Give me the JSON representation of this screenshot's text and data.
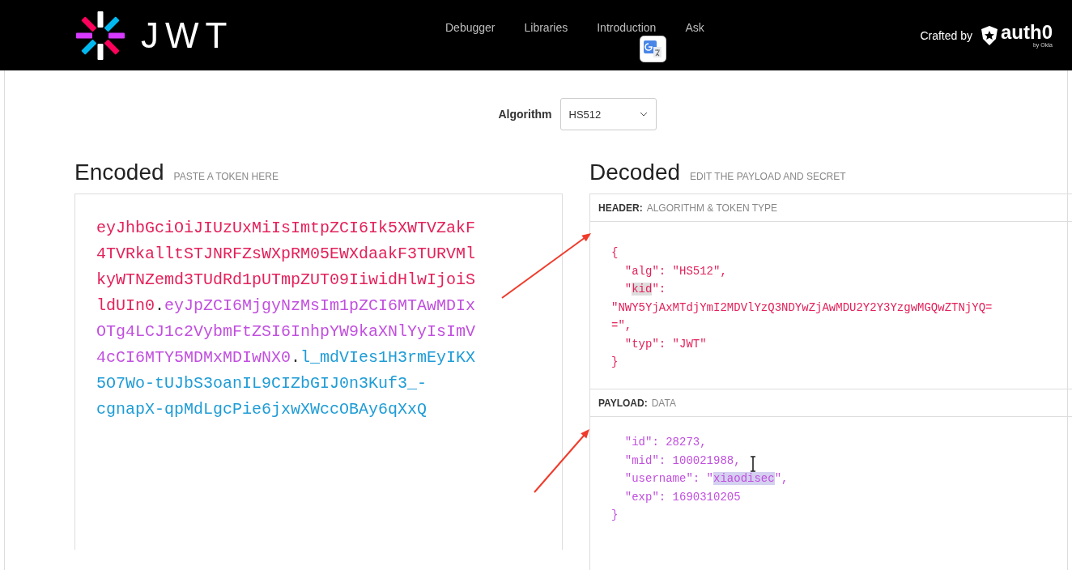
{
  "nav": {
    "logo": "JWT",
    "links": [
      {
        "label": "Debugger"
      },
      {
        "label": "Libraries"
      },
      {
        "label": "Introduction"
      },
      {
        "label": "Ask"
      }
    ],
    "crafted_by": "Crafted by",
    "brand": "auth0",
    "brand_sub": "by Okta"
  },
  "algorithm": {
    "label": "Algorithm",
    "value": "HS512"
  },
  "encoded": {
    "title": "Encoded",
    "hint": "PASTE A TOKEN HERE",
    "token": [
      {
        "kind": "header",
        "text": "eyJhbGciOiJIUzUxMiIsImtpZCI6Ik5XWTVZakF4TVRkalltSTJNRFZsWXpRM05EWXdaakF3TURVMlkyWTNZemd3TUdRd1pUTmpZUT09IiwidHlwIjoiSldUIn0"
      },
      {
        "kind": "separator",
        "text": "."
      },
      {
        "kind": "payload",
        "text": "eyJpZCI6MjgyNzMsIm1pZCI6MTAwMDIxOTg4LCJ1c2VybmFtZSI6InhpYW9kaXNlYyIsImV4cCI6MTY5MDMxMDIwNX0"
      },
      {
        "kind": "separator",
        "text": "."
      },
      {
        "kind": "signature",
        "text": "l_mdVIes1H3rmEyIKX5O7Wo-tUJbS3oanIL9CIZbGIJ0n3Kuf3_-cgnapX-qpMdLgcPie6jxwXWccOBAy6qXxQ"
      }
    ]
  },
  "decoded": {
    "title": "Decoded",
    "hint": "EDIT THE PAYLOAD AND SECRET",
    "sections": [
      {
        "kind": "header",
        "label": "HEADER:",
        "sublabel": "ALGORITHM & TOKEN TYPE",
        "lines": [
          {
            "segments": [
              {
                "text": "{",
                "highlighted": false
              }
            ]
          },
          {
            "segments": [
              {
                "text": "  \"alg\": \"HS512\",",
                "highlighted": false
              }
            ]
          },
          {
            "segments": [
              {
                "text": "  \"",
                "highlighted": false
              },
              {
                "text": "kid",
                "highlighted": true
              },
              {
                "text": "\":",
                "highlighted": false
              }
            ]
          },
          {
            "segments": [
              {
                "text": "\"NWY5YjAxMTdjYmI2MDVlYzQ3NDYwZjAwMDU2Y2Y3YzgwMGQwZTNjYQ=",
                "highlighted": false
              }
            ]
          },
          {
            "segments": [
              {
                "text": "=\",",
                "highlighted": false
              }
            ]
          },
          {
            "segments": [
              {
                "text": "  \"typ\": \"JWT\"",
                "highlighted": false
              }
            ]
          },
          {
            "segments": [
              {
                "text": "}",
                "highlighted": false
              }
            ]
          }
        ]
      },
      {
        "kind": "payload",
        "label": "PAYLOAD:",
        "sublabel": "DATA",
        "lines": [
          {
            "segments": [
              {
                "text": "  \"id\": 28273,",
                "highlighted": false
              }
            ]
          },
          {
            "segments": [
              {
                "text": "  \"mid\": 100021988,",
                "highlighted": false
              }
            ]
          },
          {
            "segments": [
              {
                "text": "  \"username\": \"",
                "highlighted": false
              },
              {
                "text": "xiaodisec",
                "highlighted": true
              },
              {
                "text": "\",",
                "highlighted": false
              }
            ]
          },
          {
            "segments": [
              {
                "text": "  \"exp\": 1690310205",
                "highlighted": false
              }
            ]
          },
          {
            "segments": [
              {
                "text": "}",
                "highlighted": false
              }
            ]
          }
        ]
      }
    ]
  }
}
